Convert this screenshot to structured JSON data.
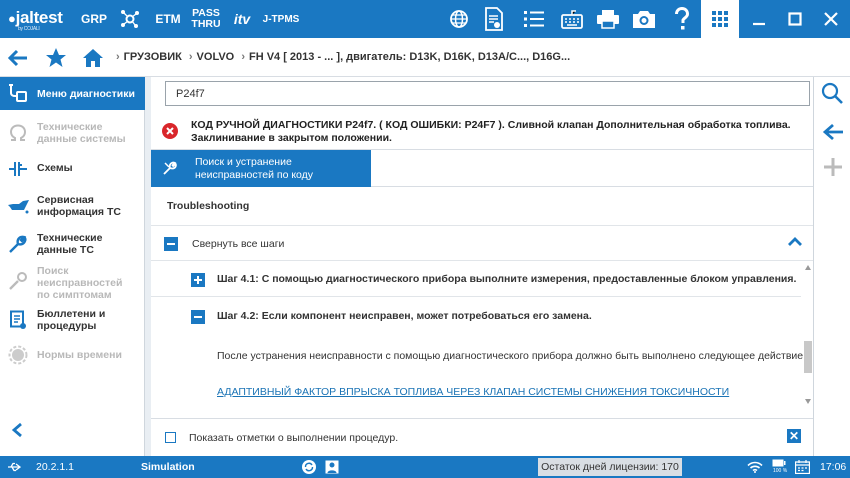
{
  "topbar": {
    "logo": "jaltest",
    "logo_sub": "by COJALI",
    "grp": "GRP",
    "etm": "ETM",
    "pass_thru_1": "PASS",
    "pass_thru_2": "THRU",
    "itv": "itv",
    "jtpms": "J-TPMS"
  },
  "breadcrumb": {
    "items": [
      "ГРУЗОВИК",
      "VOLVO",
      "FH V4 [ 2013 - ... ], двигатель: D13K, D16K, D13A/C..., D16G..."
    ]
  },
  "sidebar": {
    "items": [
      {
        "label": "Меню диагностики",
        "active": true,
        "disabled": false
      },
      {
        "label": "Технические данные системы",
        "active": false,
        "disabled": true
      },
      {
        "label": "Схемы",
        "active": false,
        "disabled": false
      },
      {
        "label": "Сервисная информация ТС",
        "active": false,
        "disabled": false
      },
      {
        "label": "Технические данные ТС",
        "active": false,
        "disabled": false
      },
      {
        "label": "Поиск неисправностей по симптомам",
        "active": false,
        "disabled": true
      },
      {
        "label": "Бюллетени и процедуры",
        "active": false,
        "disabled": false
      },
      {
        "label": "Нормы времени",
        "active": false,
        "disabled": true
      }
    ]
  },
  "main": {
    "search_value": "P24f7",
    "error_text": "КОД РУЧНОЙ ДИАГНОСТИКИ P24f7. ( КОД ОШИБКИ: P24F7 ). Сливной клапан Дополнительная обработка топлива. Заклинивание в закрытом положении.",
    "tab_label_1": "Поиск и устранение",
    "tab_label_2": "неисправностей по коду",
    "section_title": "Troubleshooting",
    "collapse_all": "Свернуть все шаги",
    "steps": [
      {
        "label": "Шаг 4.1: С помощью диагностического прибора выполните измерения, предоставленные блоком управления.",
        "expanded": false
      },
      {
        "label": "Шаг 4.2: Если компонент неисправен, может потребоваться его замена.",
        "expanded": true
      }
    ],
    "step_desc": "После устранения неисправности с помощью диагностического прибора должно быть выполнено следующее действие:",
    "link": "АДАПТИВНЫЙ ФАКТОР ВПРЫСКА ТОПЛИВА ЧЕРЕЗ КЛАПАН СИСТЕМЫ СНИЖЕНИЯ ТОКСИЧНОСТИ",
    "show_marks": "Показать отметки о выполнении процедур."
  },
  "status": {
    "version": "20.2.1.1",
    "mode": "Simulation",
    "license": "Остаток дней лицензии: 170",
    "battery_pct": "100 %",
    "time": "17:06"
  },
  "colors": {
    "accent": "#1a78c2",
    "error": "#d9262b",
    "link": "#1a73b5"
  }
}
